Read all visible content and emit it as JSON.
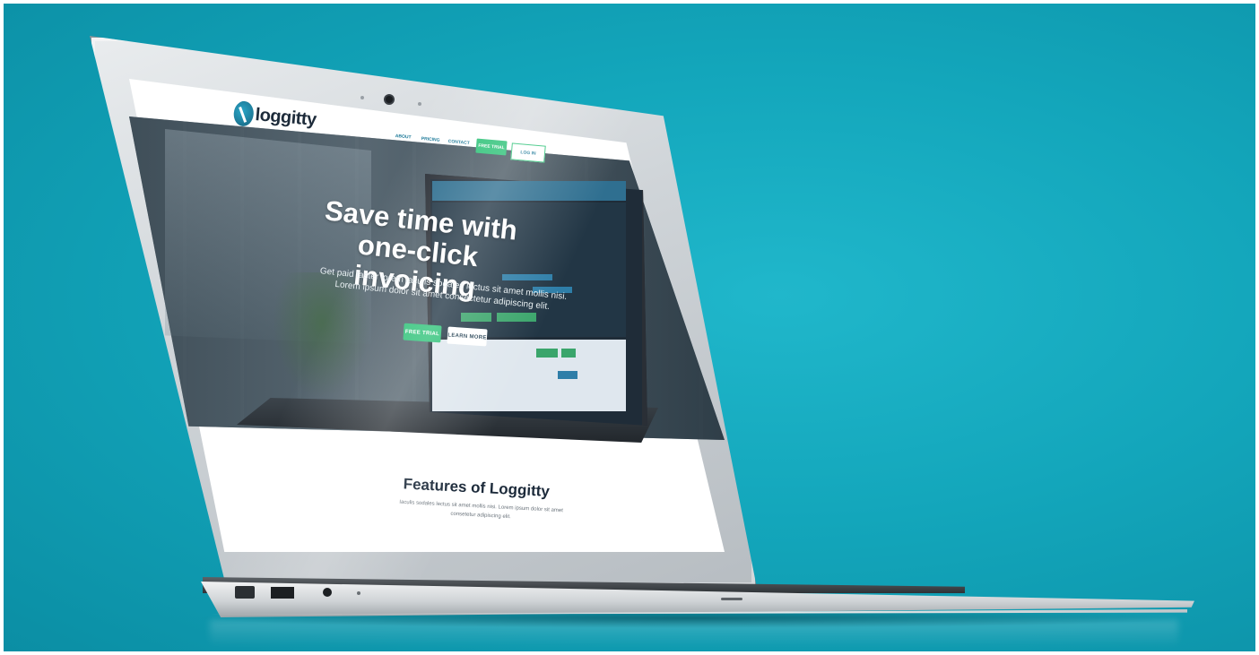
{
  "site": {
    "logo_text": "loggitty",
    "nav": {
      "about": "ABOUT",
      "pricing": "PRICING",
      "contact": "CONTACT",
      "free_trial": "FREE TRIAL",
      "log_in": "LOG IN"
    },
    "hero": {
      "headline_line1": "Save time with",
      "headline_line2": "one-click invoicing",
      "subhead": "Get paid faster lorem iaculis sodales lectus sit amet mollis nisi. Lorem ipsum dolor sit amet consectetur adipiscing elit.",
      "free_trial_button": "FREE TRIAL",
      "learn_more_button": "LEARN MORE"
    },
    "features": {
      "title": "Features of Loggitty",
      "description": "Iaculis sodales lectus sit amet mollis nisi. Lorem ipsum dolor sit amet consetetur adipiscing elit."
    }
  },
  "colors": {
    "background": "#13a6bb",
    "accent_green": "#2ec278",
    "link_blue": "#1e7a99",
    "title_dark": "#1c2a3a"
  }
}
